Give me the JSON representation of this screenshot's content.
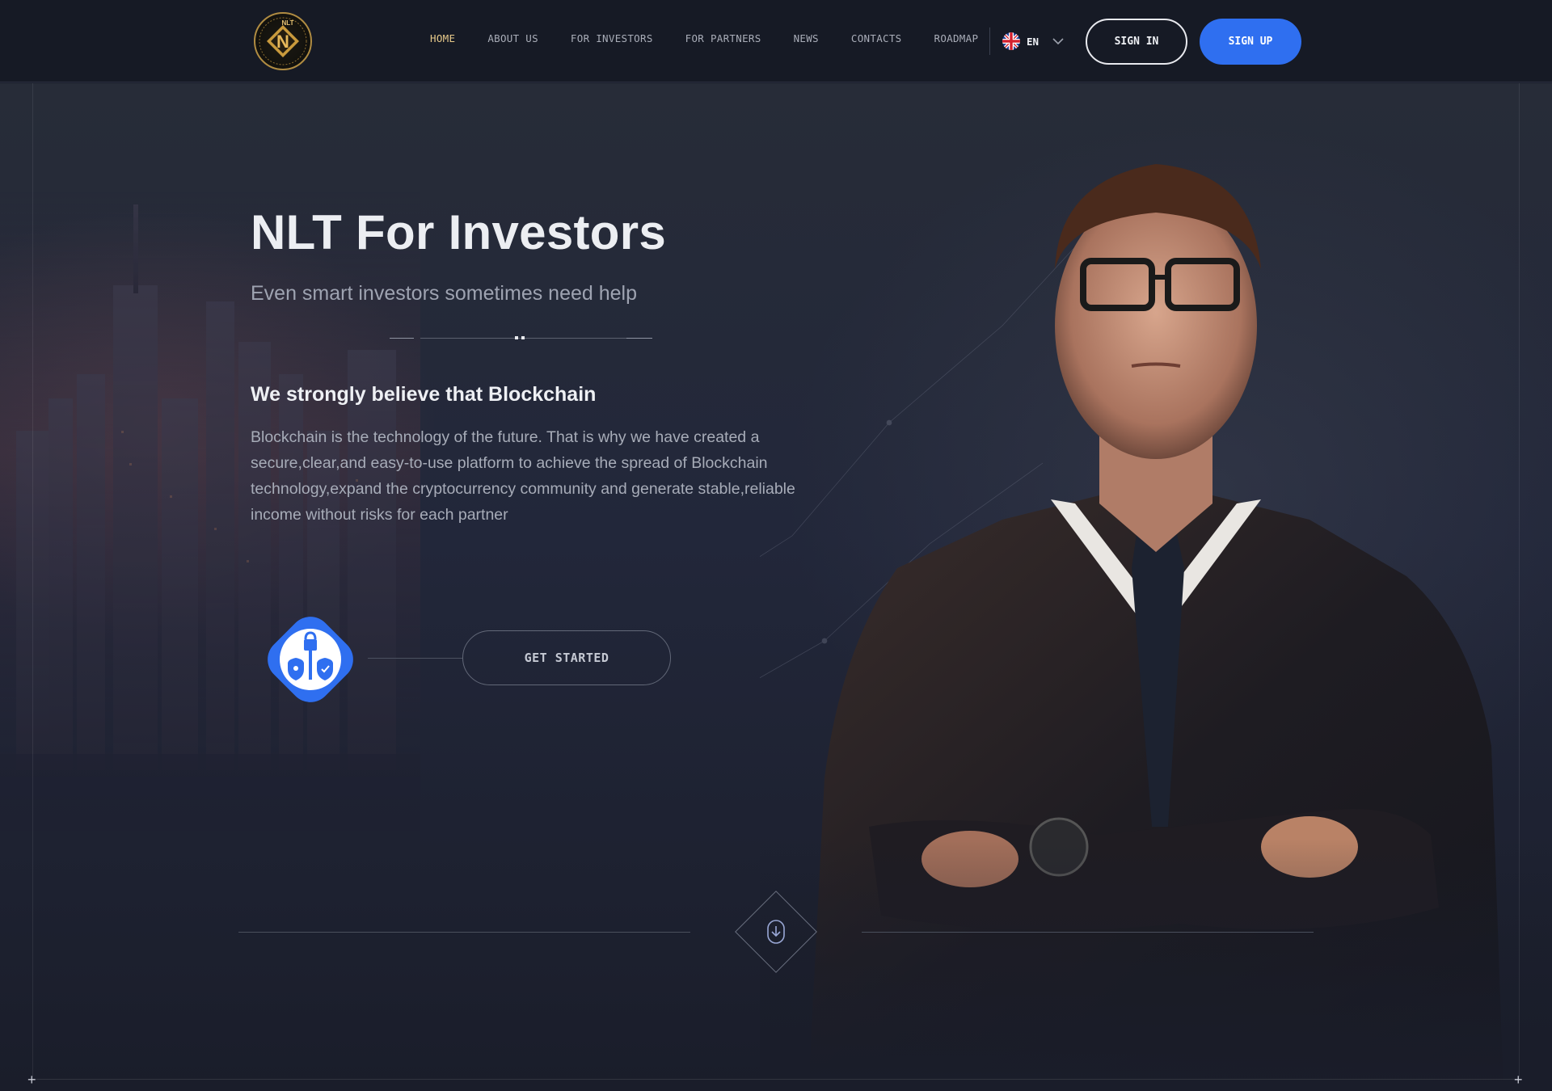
{
  "header": {
    "logo_text": "NLT",
    "nav": [
      {
        "label": "HOME",
        "active": true
      },
      {
        "label": "ABOUT US",
        "active": false
      },
      {
        "label": "FOR INVESTORS",
        "active": false
      },
      {
        "label": "FOR PARTNERS",
        "active": false
      },
      {
        "label": "NEWS",
        "active": false
      },
      {
        "label": "CONTACTS",
        "active": false
      },
      {
        "label": "ROADMAP",
        "active": false
      }
    ],
    "language": {
      "code": "EN",
      "flag_icon": "uk-flag-icon"
    },
    "sign_in": "SIGN IN",
    "sign_up": "SIGN UP"
  },
  "hero": {
    "title": "NLT For Investors",
    "subtitle": "Even smart investors sometimes need help",
    "lead": "We strongly believe that Blockchain",
    "body": "Blockchain is the technology of the future. That is why we have created a secure,clear,and easy-to-use platform to achieve the spread of Blockchain technology,expand the cryptocurrency community and generate stable,reliable income without risks for each partner",
    "cta": "GET STARTED",
    "badge_icon": "security-shield-icon",
    "scroll_icon": "scroll-down-icon"
  },
  "colors": {
    "accent_blue": "#2f6ff0",
    "active_nav": "#e7c98a",
    "background": "#1a1e2b",
    "logo_gold": "#b08c42"
  }
}
